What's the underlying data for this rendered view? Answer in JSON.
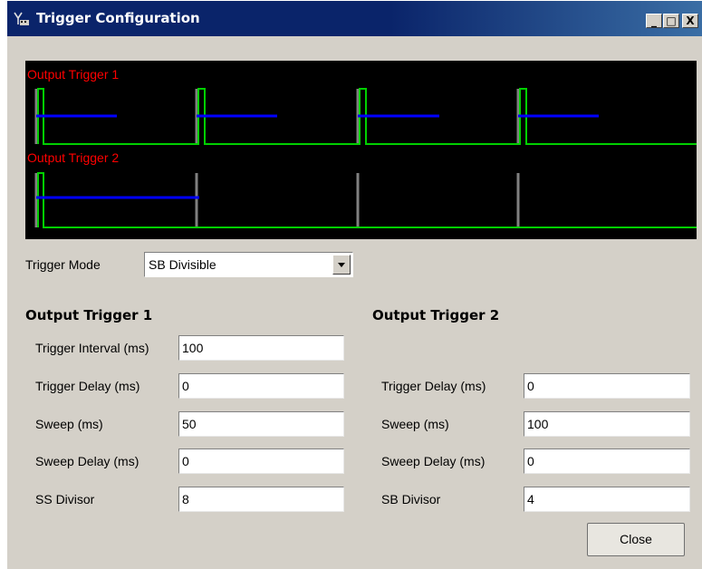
{
  "window": {
    "title": "Trigger Configuration",
    "minimize": "_",
    "maximize": "□",
    "close": "X"
  },
  "scope": {
    "trace1_label": "Output Trigger 1",
    "trace2_label": "Output Trigger 2",
    "colors": {
      "background": "#000000",
      "label": "#ff0000",
      "trigger": "#00cc00",
      "sweep": "#0000ff",
      "marker": "#808080"
    }
  },
  "trigger_mode": {
    "label": "Trigger Mode",
    "value": "SB Divisible"
  },
  "output1": {
    "heading": "Output Trigger 1",
    "interval_label": "Trigger Interval (ms)",
    "interval_value": "100",
    "delay_label": "Trigger Delay (ms)",
    "delay_value": "0",
    "sweep_label": "Sweep (ms)",
    "sweep_value": "50",
    "sweep_delay_label": "Sweep Delay (ms)",
    "sweep_delay_value": "0",
    "divisor_label": "SS Divisor",
    "divisor_value": "8"
  },
  "output2": {
    "heading": "Output Trigger 2",
    "delay_label": "Trigger Delay (ms)",
    "delay_value": "0",
    "sweep_label": "Sweep (ms)",
    "sweep_value": "100",
    "sweep_delay_label": "Sweep Delay (ms)",
    "sweep_delay_value": "0",
    "divisor_label": "SB Divisor",
    "divisor_value": "4"
  },
  "buttons": {
    "close": "Close"
  }
}
